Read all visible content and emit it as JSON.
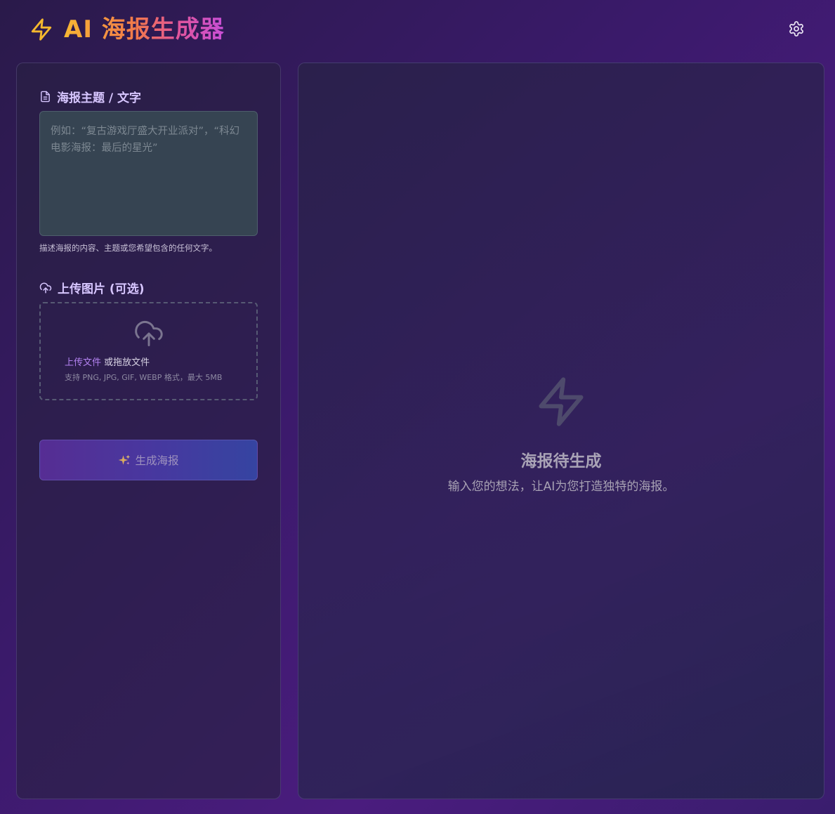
{
  "header": {
    "title": "AI 海报生成器",
    "logo_icon": "lightning-icon",
    "settings_icon": "gear-icon"
  },
  "topic": {
    "label": "海报主题 / 文字",
    "icon": "document-icon",
    "placeholder": "例如：“复古游戏厅盛大开业派对”，“科幻电影海报：最后的星光”",
    "value": "",
    "help": "描述海报的内容、主题或您希望包含的任何文字。"
  },
  "upload": {
    "label": "上传图片 (可选)",
    "icon": "cloud-upload-icon",
    "link_text": "上传文件",
    "or_text": " 或拖放文件",
    "hint": "支持 PNG, JPG, GIF, WEBP 格式，最大 5MB"
  },
  "generate": {
    "label": "生成海报",
    "icon": "sparkles-icon"
  },
  "preview": {
    "icon": "lightning-icon",
    "title": "海报待生成",
    "subtitle": "输入您的想法，让AI为您打造独特的海报。"
  },
  "colors": {
    "accent": "#b483f2",
    "title_gradient_start": "#f7b733",
    "title_gradient_end": "#c84fd8",
    "logo": "#f5b82e"
  }
}
